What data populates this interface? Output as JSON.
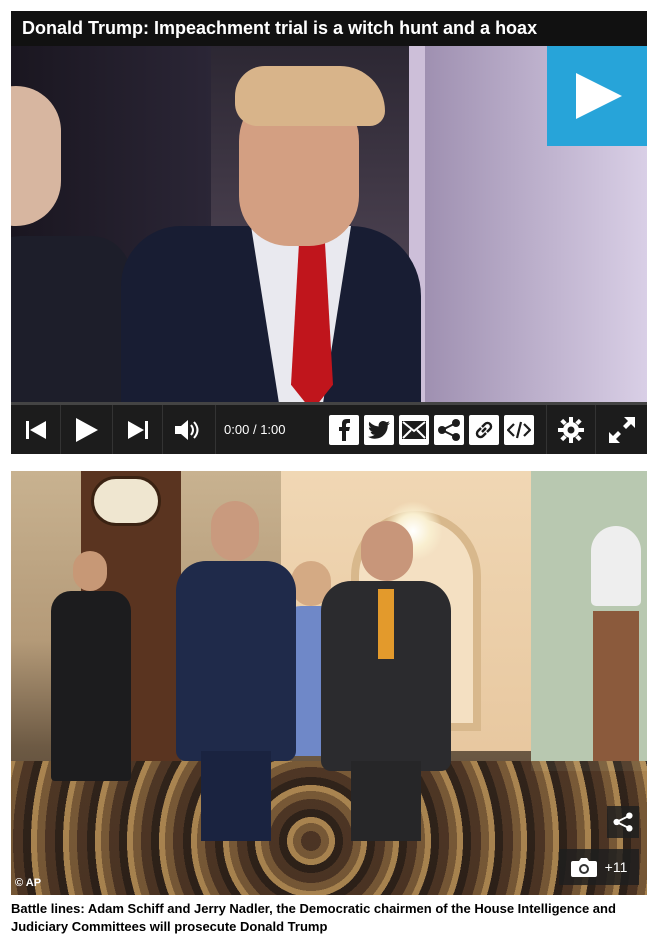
{
  "video": {
    "title": "Donald Trump: Impeachment trial is a witch hunt and a hoax",
    "time_current": "0:00",
    "time_separator": "/",
    "time_total": "1:00",
    "accent": "#27a4d9"
  },
  "controls": {
    "icons": [
      "skip-back-icon",
      "play-icon",
      "skip-forward-icon",
      "volume-icon",
      "facebook-icon",
      "twitter-icon",
      "email-icon",
      "share-icon",
      "link-icon",
      "embed-icon",
      "gear-icon",
      "fullscreen-icon"
    ]
  },
  "photo": {
    "credit": "© AP",
    "gallery_count": "+11"
  },
  "caption": "Battle lines: Adam Schiff and Jerry Nadler, the Democratic chairmen of the House Intelligence and Judiciary Committees will prosecute Donald Trump"
}
